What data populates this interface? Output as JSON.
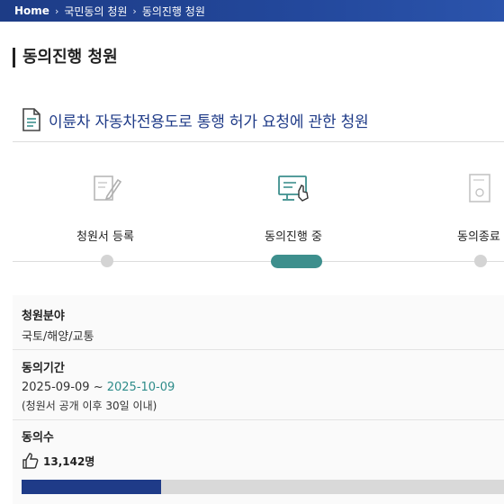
{
  "breadcrumb": {
    "home": "Home",
    "level1": "국민동의 청원",
    "level2": "동의진행 청원"
  },
  "page_title": "동의진행 청원",
  "petition": {
    "title": "이륜차 자동차전용도로 통행 허가 요청에 관한 청원"
  },
  "steps": [
    {
      "label": "청원서 등록",
      "icon": "pen-document-icon",
      "state": "done"
    },
    {
      "label": "동의진행 중",
      "icon": "signing-monitor-icon",
      "state": "active"
    },
    {
      "label": "동의종료",
      "icon": "certificate-icon",
      "state": "pending"
    }
  ],
  "info": {
    "field_label": "청원분야",
    "field_value": "국토/해양/교통",
    "period_label": "동의기간",
    "period_start": "2025-09-09",
    "period_sep": " ~ ",
    "period_end": "2025-10-09",
    "period_note": "(청원서 공개 이후 30일 이내)",
    "count_label": "동의수",
    "count_value": "13,142명",
    "progress": 0.29
  },
  "colors": {
    "header": "#23489c",
    "accent_teal": "#3d8f8d",
    "title_blue": "#1f3b88",
    "bar_fill": "#1f3b88"
  }
}
